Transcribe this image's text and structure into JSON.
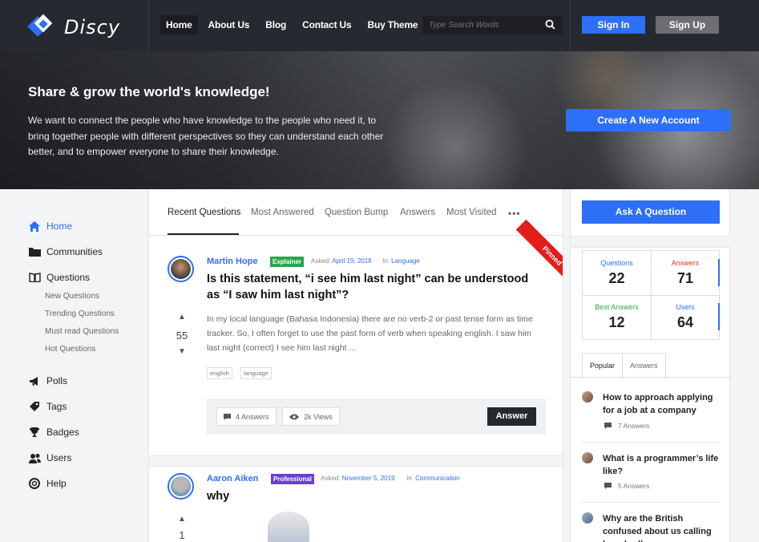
{
  "brand": {
    "name": "Discy",
    "accent": "#2d6ff7",
    "dark": "#272930"
  },
  "nav": {
    "items": [
      {
        "label": "Home",
        "active": true
      },
      {
        "label": "About Us"
      },
      {
        "label": "Blog"
      },
      {
        "label": "Contact Us"
      },
      {
        "label": "Buy Theme"
      }
    ]
  },
  "search": {
    "placeholder": "Type Search Words",
    "icon": "search-icon"
  },
  "auth": {
    "signin": "Sign In",
    "signup": "Sign Up"
  },
  "hero": {
    "title": "Share & grow the world's knowledge!",
    "text": "We want to connect the people who have knowledge to the people who need it, to bring together people with different perspectives so they can understand each other better, and to empower everyone to share their knowledge.",
    "cta": "Create A New Account"
  },
  "sidebar": {
    "items": [
      {
        "label": "Home",
        "icon": "home-icon",
        "active": true
      },
      {
        "label": "Communities",
        "icon": "folder-icon"
      },
      {
        "label": "Questions",
        "icon": "book-icon"
      },
      {
        "label": "Polls",
        "icon": "megaphone-icon"
      },
      {
        "label": "Tags",
        "icon": "tag-icon"
      },
      {
        "label": "Badges",
        "icon": "trophy-icon"
      },
      {
        "label": "Users",
        "icon": "users-icon"
      },
      {
        "label": "Help",
        "icon": "lifebuoy-icon"
      }
    ],
    "sub": [
      "New Questions",
      "Trending Questions",
      "Must read Questions",
      "Hot Questions"
    ]
  },
  "tabs": {
    "items": [
      "Recent Questions",
      "Most Answered",
      "Question Bump",
      "Answers",
      "Most Visited"
    ],
    "more": "•••"
  },
  "questions": [
    {
      "author": "Martin Hope",
      "badge": "Explainer",
      "badge_color": "#2aa54c",
      "asked_label": "Asked:",
      "asked_date": "April 19, 2018",
      "in_label": "In:",
      "category": "Language",
      "title": "Is this statement, “i see him last night” can be understood as “I saw him last night”?",
      "body": "In my local language (Bahasa Indonesia) there are no verb-2 or past tense form as time tracker. So, I often forget to use the past form of verb when speaking english. I saw him last night (correct) I see him last night ...",
      "votes": "55",
      "tags": [
        "english",
        "language"
      ],
      "answers": "4 Answers",
      "views": "2k Views",
      "answer_btn": "Answer",
      "pinned": "Pinned"
    },
    {
      "author": "Aaron Aiken",
      "badge": "Professional",
      "badge_color": "#6b3fd4",
      "asked_label": "Asked:",
      "asked_date": "November 5, 2019",
      "in_label": "In:",
      "category": "Communication",
      "title": "why",
      "votes": "1"
    }
  ],
  "right": {
    "ask": "Ask A Question",
    "stats": [
      {
        "label": "Questions",
        "value": "22",
        "color": "#2d6ff7"
      },
      {
        "label": "Answers",
        "value": "71",
        "color": "#e5332a"
      },
      {
        "label": "Best Answers",
        "value": "12",
        "color": "#2aa54c"
      },
      {
        "label": "Users",
        "value": "64",
        "color": "#2d6ff7"
      }
    ],
    "tabs": [
      "Popular",
      "Answers"
    ],
    "popular": [
      {
        "title": "How to approach applying for a job at a company",
        "answers": "7 Answers"
      },
      {
        "title": "What is a programmer’s life like?",
        "answers": "5 Answers"
      },
      {
        "title": "Why are the British confused about us calling bread rolls"
      }
    ]
  }
}
